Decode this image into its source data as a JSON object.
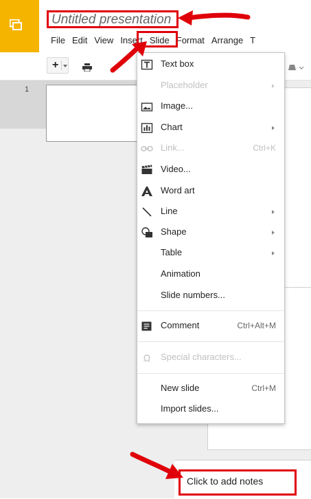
{
  "app": {
    "title": "Untitled presentation"
  },
  "menubar": [
    {
      "label": "File"
    },
    {
      "label": "Edit"
    },
    {
      "label": "View"
    },
    {
      "label": "Insert"
    },
    {
      "label": "Slide"
    },
    {
      "label": "Format"
    },
    {
      "label": "Arrange"
    },
    {
      "label": "T"
    }
  ],
  "filmstrip": {
    "slide_number": "1"
  },
  "insert_menu": {
    "items": [
      {
        "label": "Text box",
        "icon": "text-box-icon",
        "shortcut": "",
        "submenu": false,
        "disabled": false
      },
      {
        "label": "Placeholder",
        "icon": "",
        "shortcut": "",
        "submenu": true,
        "disabled": true
      },
      {
        "label": "Image...",
        "icon": "image-icon",
        "shortcut": "",
        "submenu": false,
        "disabled": false
      },
      {
        "label": "Chart",
        "icon": "chart-icon",
        "shortcut": "",
        "submenu": true,
        "disabled": false
      },
      {
        "label": "Link...",
        "icon": "link-icon",
        "shortcut": "Ctrl+K",
        "submenu": false,
        "disabled": true
      },
      {
        "label": "Video...",
        "icon": "video-icon",
        "shortcut": "",
        "submenu": false,
        "disabled": false
      },
      {
        "label": "Word art",
        "icon": "word-art-icon",
        "shortcut": "",
        "submenu": false,
        "disabled": false
      },
      {
        "label": "Line",
        "icon": "line-icon",
        "shortcut": "",
        "submenu": true,
        "disabled": false
      },
      {
        "label": "Shape",
        "icon": "shape-icon",
        "shortcut": "",
        "submenu": true,
        "disabled": false
      },
      {
        "label": "Table",
        "icon": "",
        "shortcut": "",
        "submenu": true,
        "disabled": false
      },
      {
        "label": "Animation",
        "icon": "",
        "shortcut": "",
        "submenu": false,
        "disabled": false
      },
      {
        "label": "Slide numbers...",
        "icon": "",
        "shortcut": "",
        "submenu": false,
        "disabled": false
      },
      {
        "label": "Comment",
        "icon": "comment-icon",
        "shortcut": "Ctrl+Alt+M",
        "submenu": false,
        "disabled": false
      },
      {
        "label": "Special characters...",
        "icon": "omega-icon",
        "shortcut": "",
        "submenu": false,
        "disabled": true
      },
      {
        "label": "New slide",
        "icon": "",
        "shortcut": "Ctrl+M",
        "submenu": false,
        "disabled": false
      },
      {
        "label": "Import slides...",
        "icon": "",
        "shortcut": "",
        "submenu": false,
        "disabled": false
      }
    ]
  },
  "notes": {
    "placeholder": "Click to add notes"
  },
  "colors": {
    "logo": "#f4b400",
    "annotation": "#e0000a"
  }
}
